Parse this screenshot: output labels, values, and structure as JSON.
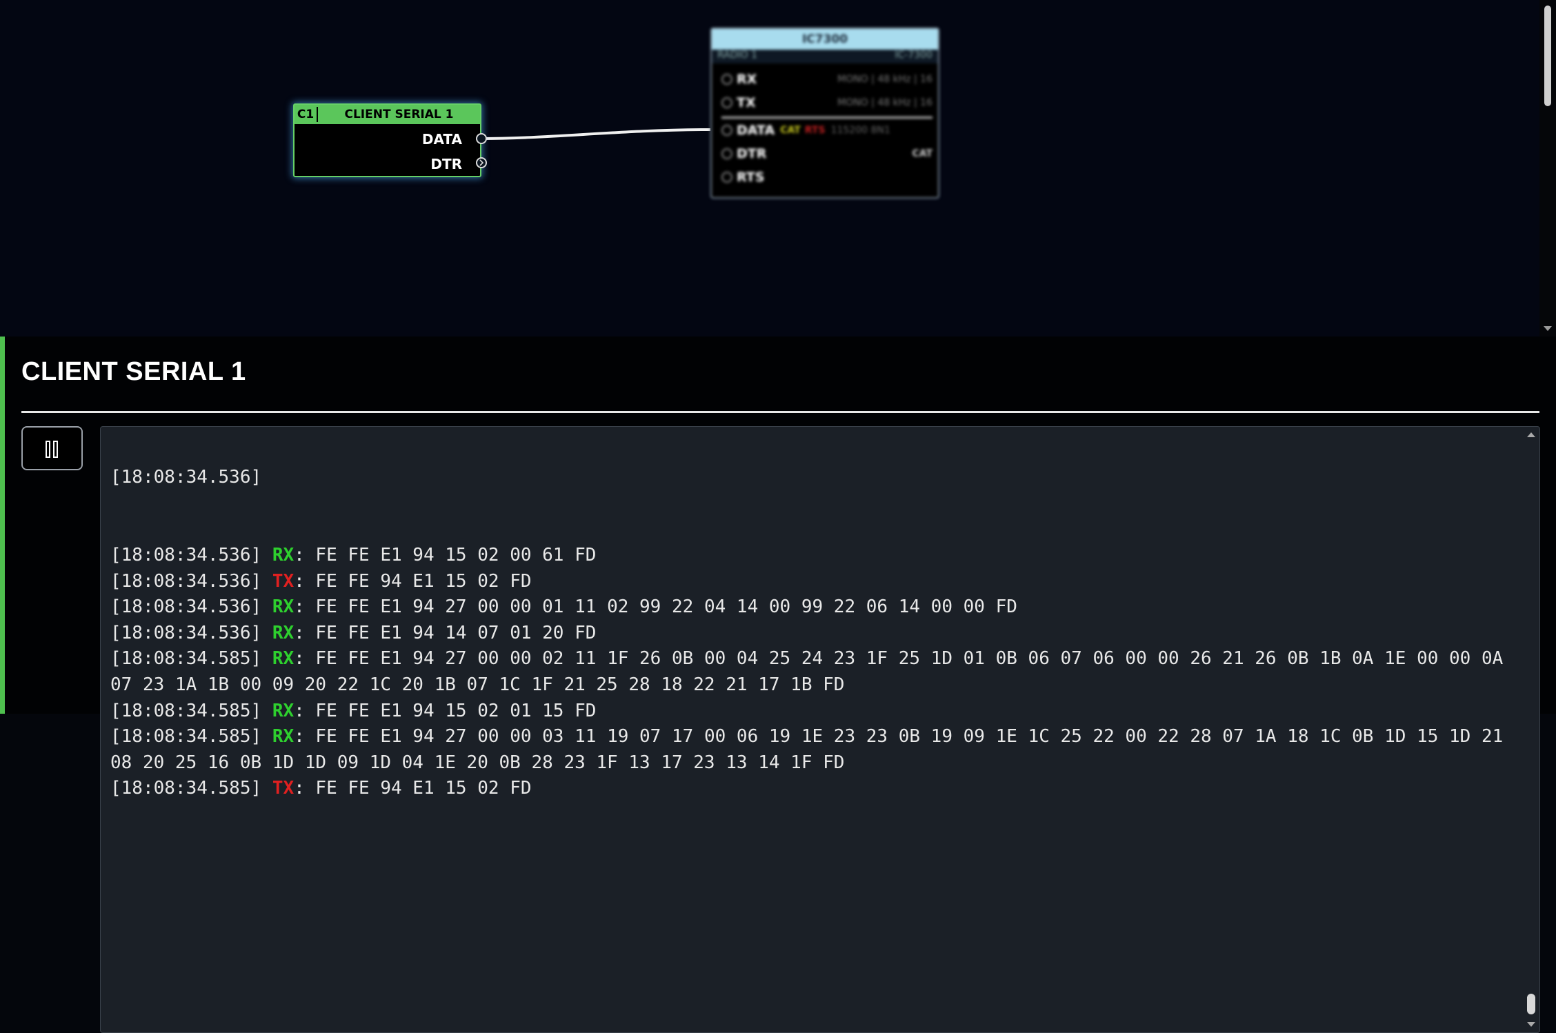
{
  "graph": {
    "client_node": {
      "id": "C1",
      "title": "CLIENT SERIAL 1",
      "ports": [
        "DATA",
        "DTR"
      ]
    },
    "radio_node": {
      "title": "IC7300",
      "subtitle_left": "RADIO 1",
      "subtitle_right": "IC-7300",
      "rows": [
        {
          "label": "RX",
          "meta": "MONO | 48 kHz | 16"
        },
        {
          "label": "TX",
          "meta": "MONO | 48 kHz | 16"
        },
        {
          "label": "DATA",
          "tag1": "CAT",
          "tag2": "RTS",
          "meta": "115200 8N1"
        },
        {
          "label": "DTR",
          "meta": "CAT"
        },
        {
          "label": "RTS",
          "meta": ""
        }
      ]
    }
  },
  "panel": {
    "title": "CLIENT SERIAL 1",
    "log": [
      {
        "time": "[18:08:34.536]",
        "dir": "RX",
        "bytes": "FE FE E1 94 15 02 00 61 FD"
      },
      {
        "time": "[18:08:34.536]",
        "dir": "TX",
        "bytes": "FE FE 94 E1 15 02 FD"
      },
      {
        "time": "[18:08:34.536]",
        "dir": "RX",
        "bytes": "FE FE E1 94 27 00 00 01 11 02 99 22 04 14 00 99 22 06 14 00 00 FD"
      },
      {
        "time": "[18:08:34.536]",
        "dir": "RX",
        "bytes": "FE FE E1 94 14 07 01 20 FD"
      },
      {
        "time": "[18:08:34.585]",
        "dir": "RX",
        "bytes": "FE FE E1 94 27 00 00 02 11 1F 26 0B 00 04 25 24 23 1F 25 1D 01 0B 06 07 06 00 00 26 21 26 0B 1B 0A 1E 00 00 0A 07 23 1A 1B 00 09 20 22 1C 20 1B 07 1C 1F 21 25 28 18 22 21 17 1B FD"
      },
      {
        "time": "[18:08:34.585]",
        "dir": "RX",
        "bytes": "FE FE E1 94 15 02 01 15 FD"
      },
      {
        "time": "[18:08:34.585]",
        "dir": "RX",
        "bytes": "FE FE E1 94 27 00 00 03 11 19 07 17 00 06 19 1E 23 23 0B 19 09 1E 1C 25 22 00 22 28 07 1A 18 1C 0B 1D 15 1D 21 08 20 25 16 0B 1D 1D 09 1D 04 1E 20 0B 28 23 1F 13 17 23 13 14 1F FD"
      },
      {
        "time": "[18:08:34.585]",
        "dir": "TX",
        "bytes": "FE FE 94 E1 15 02 FD"
      }
    ]
  },
  "colors": {
    "rx": "#2ed02e",
    "tx": "#e02020",
    "accent": "#4fc04f"
  }
}
